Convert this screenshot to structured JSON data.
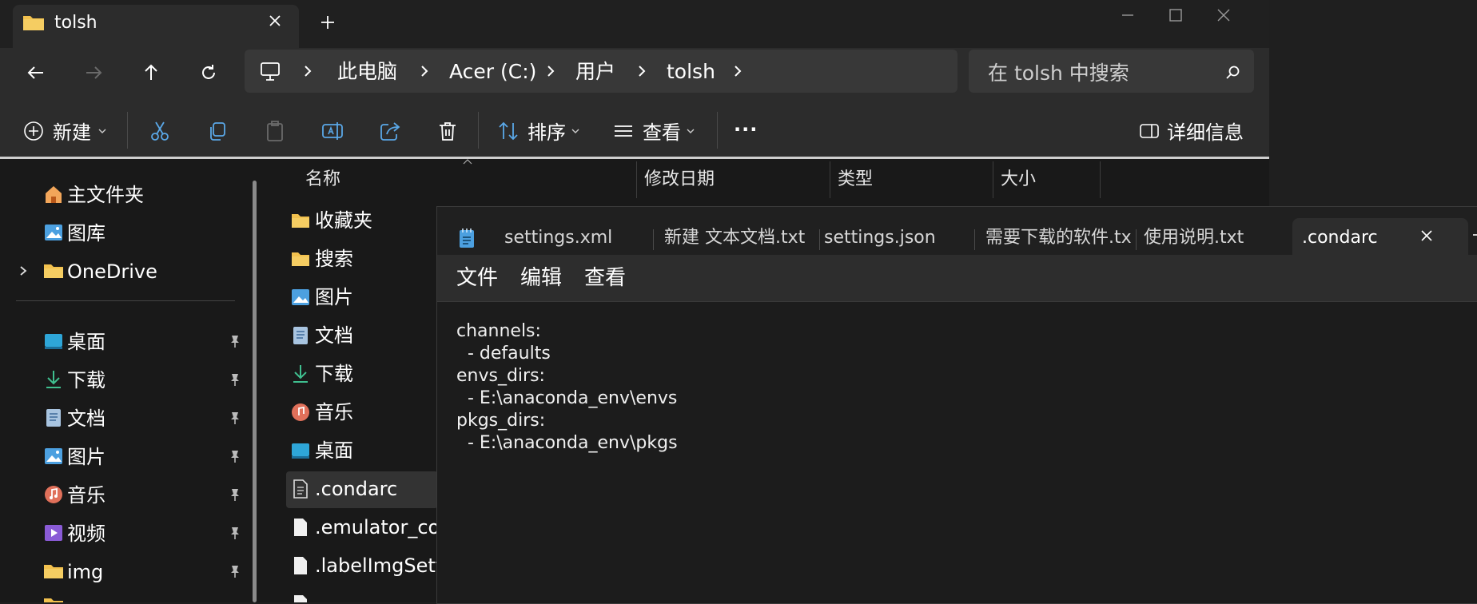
{
  "explorer": {
    "tab_title": "tolsh",
    "new_tab": "+",
    "breadcrumb": [
      "此电脑",
      "Acer (C:)",
      "用户",
      "tolsh"
    ],
    "search_placeholder": "在 tolsh 中搜索",
    "toolbar": {
      "new_label": "新建",
      "sort_label": "排序",
      "view_label": "查看",
      "more_label": "···",
      "details_label": "详细信息"
    },
    "nav_items": [
      {
        "label": "主文件夹",
        "icon": "home-icon"
      },
      {
        "label": "图库",
        "icon": "gallery-icon"
      },
      {
        "label": "OneDrive",
        "icon": "folder-icon",
        "expandable": true
      },
      {
        "label": "桌面",
        "icon": "desktop-icon",
        "pinned": true
      },
      {
        "label": "下载",
        "icon": "download-icon",
        "pinned": true
      },
      {
        "label": "文档",
        "icon": "document-icon",
        "pinned": true
      },
      {
        "label": "图片",
        "icon": "pictures-icon",
        "pinned": true
      },
      {
        "label": "音乐",
        "icon": "music-icon",
        "pinned": true
      },
      {
        "label": "视频",
        "icon": "video-icon",
        "pinned": true
      },
      {
        "label": "img",
        "icon": "folder-icon",
        "pinned": true
      }
    ],
    "columns": [
      "名称",
      "修改日期",
      "类型",
      "大小"
    ],
    "files": [
      {
        "label": "收藏夹",
        "icon": "folder-icon"
      },
      {
        "label": "搜索",
        "icon": "folder-icon"
      },
      {
        "label": "图片",
        "icon": "pictures-icon"
      },
      {
        "label": "文档",
        "icon": "document-icon"
      },
      {
        "label": "下载",
        "icon": "download-icon"
      },
      {
        "label": "音乐",
        "icon": "music-icon"
      },
      {
        "label": "桌面",
        "icon": "desktop-icon"
      },
      {
        "label": ".condarc",
        "icon": "file-icon",
        "selected": true
      },
      {
        "label": ".emulator_con",
        "icon": "file-icon"
      },
      {
        "label": ".labelImgSettin",
        "icon": "file-icon"
      }
    ]
  },
  "notepad": {
    "tabs": [
      "settings.xml",
      "新建 文本文档.txt",
      "settings.json",
      "需要下载的软件.tx",
      "使用说明.txt",
      ".condarc"
    ],
    "active_tab": ".condarc",
    "menus": [
      "文件",
      "编辑",
      "查看"
    ],
    "content": "channels:\n  - defaults\nenvs_dirs:\n  - E:\\anaconda_env\\envs\npkgs_dirs:\n  - E:\\anaconda_env\\pkgs"
  },
  "colors": {
    "folder": "#f2c14e",
    "accent_blue": "#4ca0e0",
    "download_green": "#3fbf8f"
  }
}
